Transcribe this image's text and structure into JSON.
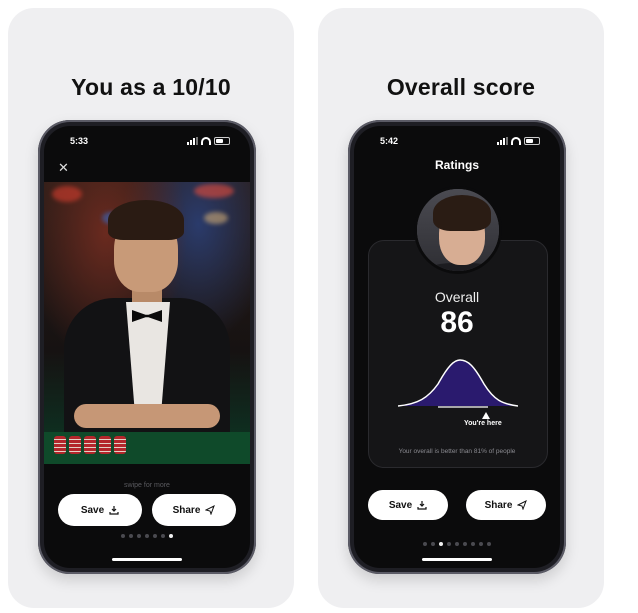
{
  "left": {
    "title": "You as a 10/10",
    "time": "5:33",
    "close_glyph": "✕",
    "swipe_hint": "swipe for more",
    "save_label": "Save",
    "share_label": "Share",
    "page_dots": 7,
    "active_dot": 6
  },
  "right": {
    "title": "Overall score",
    "time": "5:42",
    "header": "Ratings",
    "overall_label": "Overall",
    "overall_value": "86",
    "marker_label": "You're here",
    "percentile_text": "Your overall is better than 81% of people",
    "save_label": "Save",
    "share_label": "Share",
    "page_dots": 9,
    "active_dot": 2
  },
  "colors": {
    "curve_fill": "#2a1a6e",
    "screen_bg": "#0b0b0c",
    "card_bg": "#efeff1"
  },
  "icons": [
    "close-icon",
    "download-icon",
    "send-icon",
    "signal-icon",
    "wifi-icon",
    "battery-icon"
  ]
}
